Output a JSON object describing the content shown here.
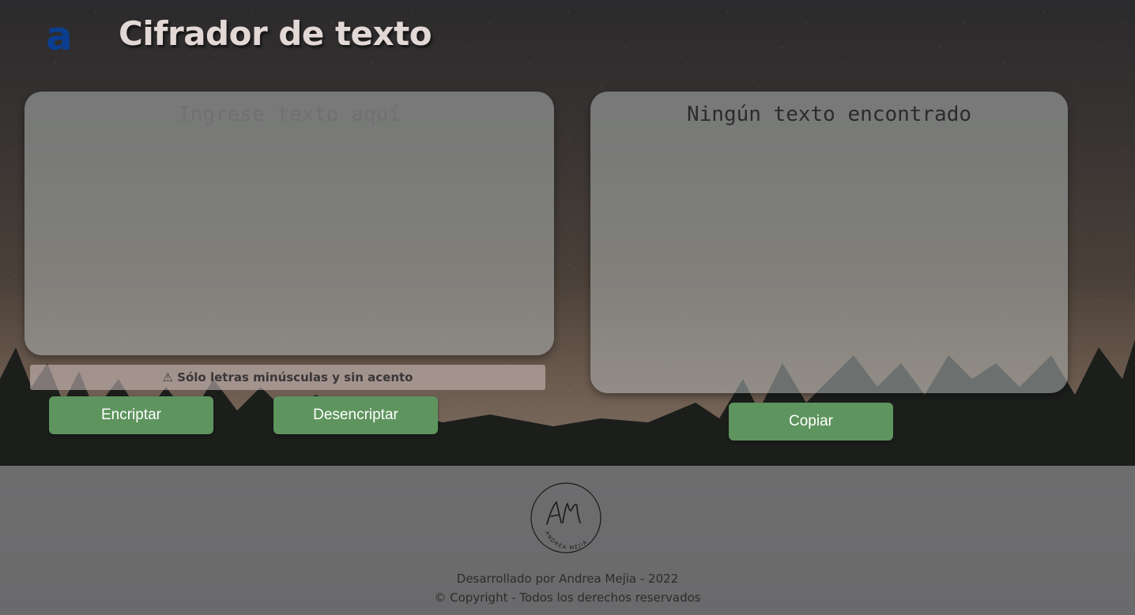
{
  "header": {
    "logo_letter": "a",
    "title": "Cifrador de texto"
  },
  "input": {
    "placeholder": "Ingrese texto aquí",
    "value": ""
  },
  "output": {
    "empty_message": "Ningún texto encontrado"
  },
  "warning": {
    "text": "⚠ Sólo letras minúsculas y sin acento"
  },
  "buttons": {
    "encrypt_label": "Encriptar",
    "decrypt_label": "Desencriptar",
    "copy_label": "Copiar"
  },
  "footer": {
    "logo_initials": "AM",
    "logo_name": "ANDREA MEJIA",
    "credit": "Desarrollado por Andrea Mejia - 2022",
    "copyright": "© Copyright - Todos los derechos reservados"
  },
  "colors": {
    "accent_button": "#5e945e",
    "logo_blue": "#0b3e8f",
    "title_text": "#e2d8d6"
  }
}
